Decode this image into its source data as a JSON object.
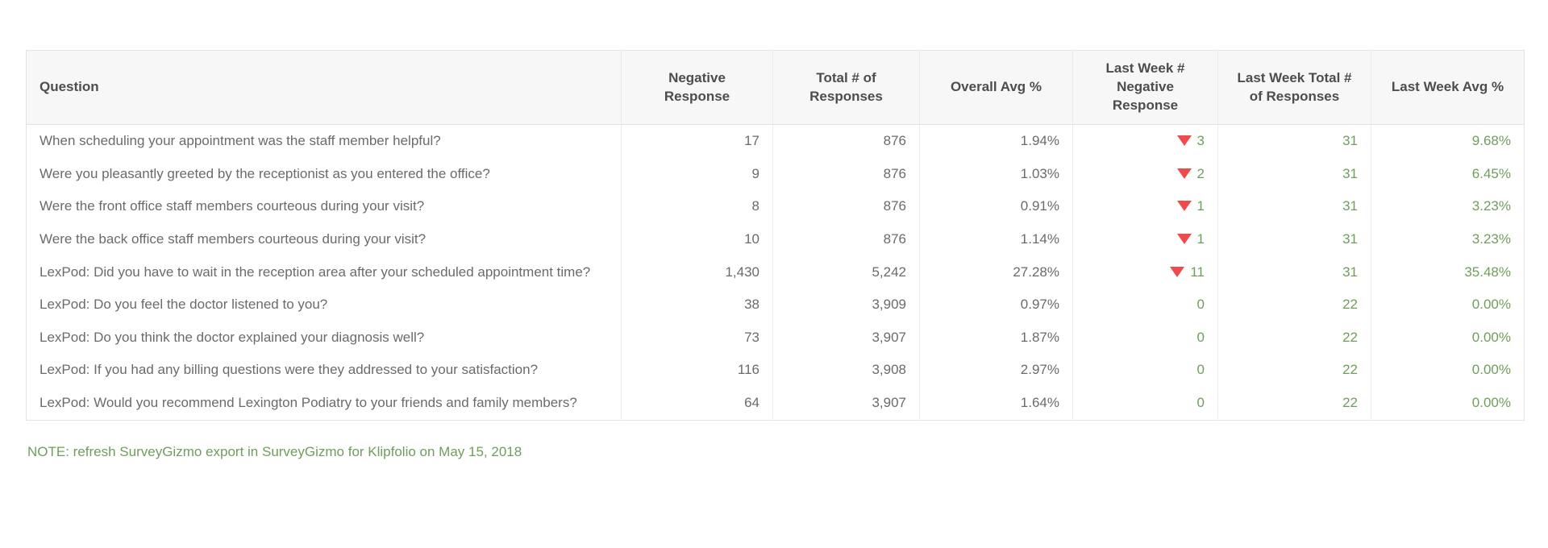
{
  "table": {
    "columns": [
      {
        "key": "question",
        "label": "Question",
        "align": "left",
        "green": false
      },
      {
        "key": "neg",
        "label": "Negative Response",
        "align": "right",
        "green": false
      },
      {
        "key": "total",
        "label": "Total # of Responses",
        "align": "right",
        "green": false
      },
      {
        "key": "avg",
        "label": "Overall Avg %",
        "align": "right",
        "green": false
      },
      {
        "key": "lw_neg",
        "label": "Last Week # Negative Response",
        "align": "right",
        "green": true
      },
      {
        "key": "lw_total",
        "label": "Last Week Total # of Responses",
        "align": "right",
        "green": true
      },
      {
        "key": "lw_avg",
        "label": "Last Week Avg %",
        "align": "right",
        "green": true
      }
    ],
    "rows": [
      {
        "question": "When scheduling your appointment was the staff member helpful?",
        "neg": "17",
        "total": "876",
        "avg": "1.94%",
        "lw_neg": "3",
        "lw_neg_indicator": "down",
        "lw_total": "31",
        "lw_avg": "9.68%"
      },
      {
        "question": "Were you pleasantly greeted by the receptionist as you entered the office?",
        "neg": "9",
        "total": "876",
        "avg": "1.03%",
        "lw_neg": "2",
        "lw_neg_indicator": "down",
        "lw_total": "31",
        "lw_avg": "6.45%"
      },
      {
        "question": "Were the front office staff members courteous during your visit?",
        "neg": "8",
        "total": "876",
        "avg": "0.91%",
        "lw_neg": "1",
        "lw_neg_indicator": "down",
        "lw_total": "31",
        "lw_avg": "3.23%"
      },
      {
        "question": "Were the back office staff members courteous during your visit?",
        "neg": "10",
        "total": "876",
        "avg": "1.14%",
        "lw_neg": "1",
        "lw_neg_indicator": "down",
        "lw_total": "31",
        "lw_avg": "3.23%"
      },
      {
        "question": "LexPod: Did you have to wait in the reception area after your scheduled appointment time?",
        "neg": "1,430",
        "total": "5,242",
        "avg": "27.28%",
        "lw_neg": "11",
        "lw_neg_indicator": "down",
        "lw_total": "31",
        "lw_avg": "35.48%"
      },
      {
        "question": "LexPod: Do you feel the doctor listened to you?",
        "neg": "38",
        "total": "3,909",
        "avg": "0.97%",
        "lw_neg": "0",
        "lw_neg_indicator": "none",
        "lw_total": "22",
        "lw_avg": "0.00%"
      },
      {
        "question": "LexPod: Do you think the doctor explained your diagnosis well?",
        "neg": "73",
        "total": "3,907",
        "avg": "1.87%",
        "lw_neg": "0",
        "lw_neg_indicator": "none",
        "lw_total": "22",
        "lw_avg": "0.00%"
      },
      {
        "question": "LexPod: If you had any billing questions were they addressed to your satisfaction?",
        "neg": "116",
        "total": "3,908",
        "avg": "2.97%",
        "lw_neg": "0",
        "lw_neg_indicator": "none",
        "lw_total": "22",
        "lw_avg": "0.00%"
      },
      {
        "question": "LexPod: Would you recommend Lexington Podiatry to your friends and family members?",
        "neg": "64",
        "total": "3,907",
        "avg": "1.64%",
        "lw_neg": "0",
        "lw_neg_indicator": "none",
        "lw_total": "22",
        "lw_avg": "0.00%"
      }
    ]
  },
  "footer": {
    "note": "NOTE: refresh SurveyGizmo export in SurveyGizmo for Klipfolio on May 15, 2018"
  },
  "colors": {
    "green": "#6f9e5c",
    "red": "#ef4b4b",
    "header_bg": "#f7f7f7",
    "text": "#6b6b6b"
  }
}
